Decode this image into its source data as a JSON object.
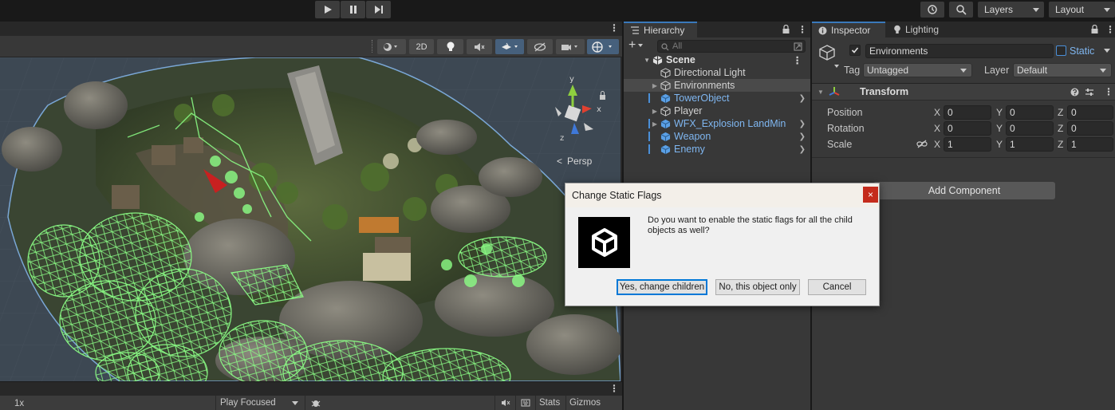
{
  "toolbar": {
    "layers_label": "Layers",
    "layout_label": "Layout"
  },
  "scene": {
    "mode_2d": "2D",
    "persp_label": "Persp",
    "gizmo_axes": {
      "y": "y",
      "x": "x",
      "z": "z"
    }
  },
  "game": {
    "scale_value": "1x",
    "play_mode": "Play Focused",
    "stats_label": "Stats",
    "gizmos_label": "Gizmos"
  },
  "hierarchy": {
    "tab_label": "Hierarchy",
    "search_placeholder": "All",
    "scene_name": "Scene",
    "items": [
      {
        "label": "Directional Light",
        "prefab": false,
        "foldable": false,
        "chevron": false
      },
      {
        "label": "Environments",
        "prefab": false,
        "foldable": true,
        "chevron": false,
        "selected": true
      },
      {
        "label": "TowerObject",
        "prefab": true,
        "foldable": false,
        "chevron": true
      },
      {
        "label": "Player",
        "prefab": false,
        "foldable": true,
        "chevron": false
      },
      {
        "label": "WFX_Explosion LandMine",
        "prefab": true,
        "foldable": true,
        "chevron": true
      },
      {
        "label": "Weapon",
        "prefab": true,
        "foldable": false,
        "chevron": true
      },
      {
        "label": "Enemy",
        "prefab": true,
        "foldable": false,
        "chevron": true
      }
    ]
  },
  "inspector": {
    "tab_label": "Inspector",
    "lighting_tab_label": "Lighting",
    "object_name": "Environments",
    "static_label": "Static",
    "tag_label": "Tag",
    "tag_value": "Untagged",
    "layer_label": "Layer",
    "layer_value": "Default",
    "transform_label": "Transform",
    "position_label": "Position",
    "rotation_label": "Rotation",
    "scale_label": "Scale",
    "x_axis": "X",
    "y_axis": "Y",
    "z_axis": "Z",
    "position": {
      "x": "0",
      "y": "0",
      "z": "0"
    },
    "rotation": {
      "x": "0",
      "y": "0",
      "z": "0"
    },
    "scale": {
      "x": "1",
      "y": "1",
      "z": "1"
    },
    "add_component_label": "Add Component"
  },
  "dialog": {
    "title": "Change Static Flags",
    "close_glyph": "×",
    "message": "Do you want to enable the static flags for all the child objects as well?",
    "yes_label": "Yes, change children",
    "no_label": "No, this object only",
    "cancel_label": "Cancel"
  },
  "colors": {
    "accent_tab": "#3a79bb",
    "prefab_text": "#7fb6f0",
    "collider_green": "#7dff7a",
    "dialog_close": "#c42b1c"
  }
}
